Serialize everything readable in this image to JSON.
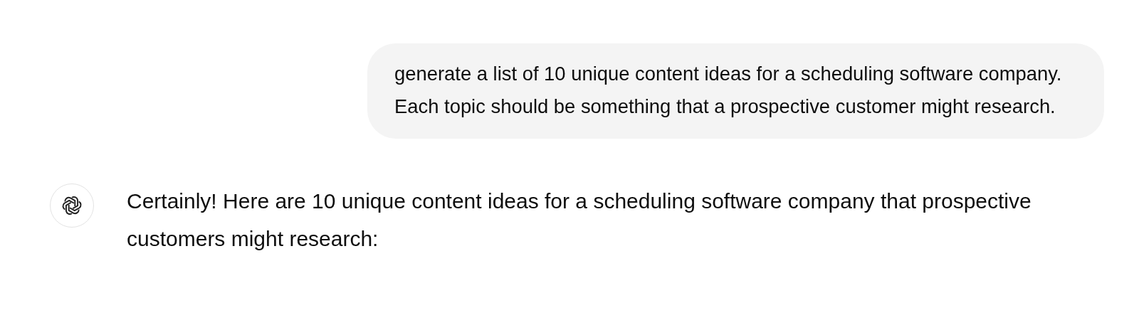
{
  "user_message": {
    "text": "generate a list of 10 unique content ideas for a scheduling software company. Each topic should be something that a prospective customer might research."
  },
  "assistant_message": {
    "text": "Certainly! Here are 10 unique content ideas for a scheduling software company that prospective customers might research:"
  }
}
